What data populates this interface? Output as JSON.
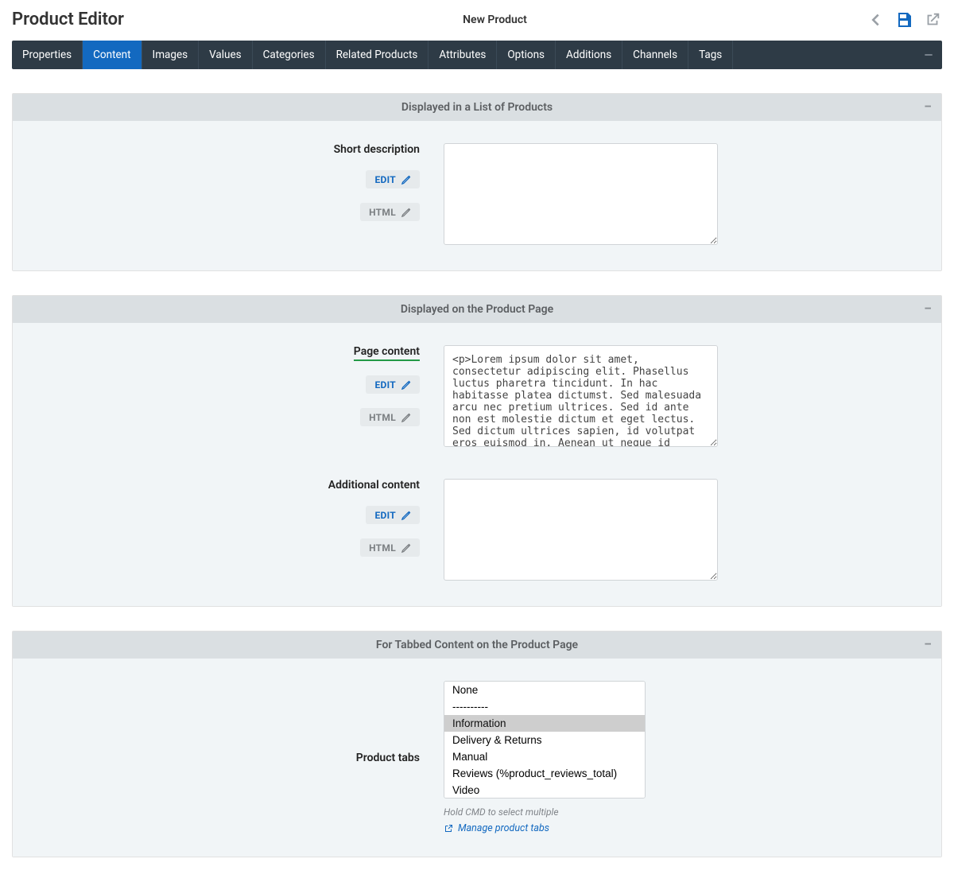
{
  "header": {
    "title": "Product Editor",
    "subtitle": "New Product"
  },
  "tabs": {
    "items": [
      "Properties",
      "Content",
      "Images",
      "Values",
      "Categories",
      "Related Products",
      "Attributes",
      "Options",
      "Additions",
      "Channels",
      "Tags"
    ],
    "active_index": 1
  },
  "buttons": {
    "edit": "EDIT",
    "html": "HTML"
  },
  "panels": {
    "list": {
      "title": "Displayed in a List of Products",
      "short_description_label": "Short description",
      "short_description_value": ""
    },
    "page": {
      "title": "Displayed on the Product Page",
      "page_content_label": "Page content",
      "page_content_value": "<p>Lorem ipsum dolor sit amet, consectetur adipiscing elit. Phasellus luctus pharetra tincidunt. In hac habitasse platea dictumst. Sed malesuada arcu nec pretium ultrices. Sed id ante non est molestie dictum et eget lectus. Sed dictum ultrices sapien, id volutpat eros euismod in. Aenean ut neque id",
      "additional_label": "Additional content",
      "additional_value": ""
    },
    "tabs": {
      "title": "For Tabbed Content on the Product Page",
      "label": "Product tabs",
      "options": [
        "None",
        "----------",
        "Information",
        "Delivery & Returns",
        "Manual",
        "Reviews (%product_reviews_total)",
        "Video",
        "----------"
      ],
      "selected_index": 2,
      "hint": "Hold CMD to select multiple",
      "manage_link": "Manage product tabs"
    }
  }
}
